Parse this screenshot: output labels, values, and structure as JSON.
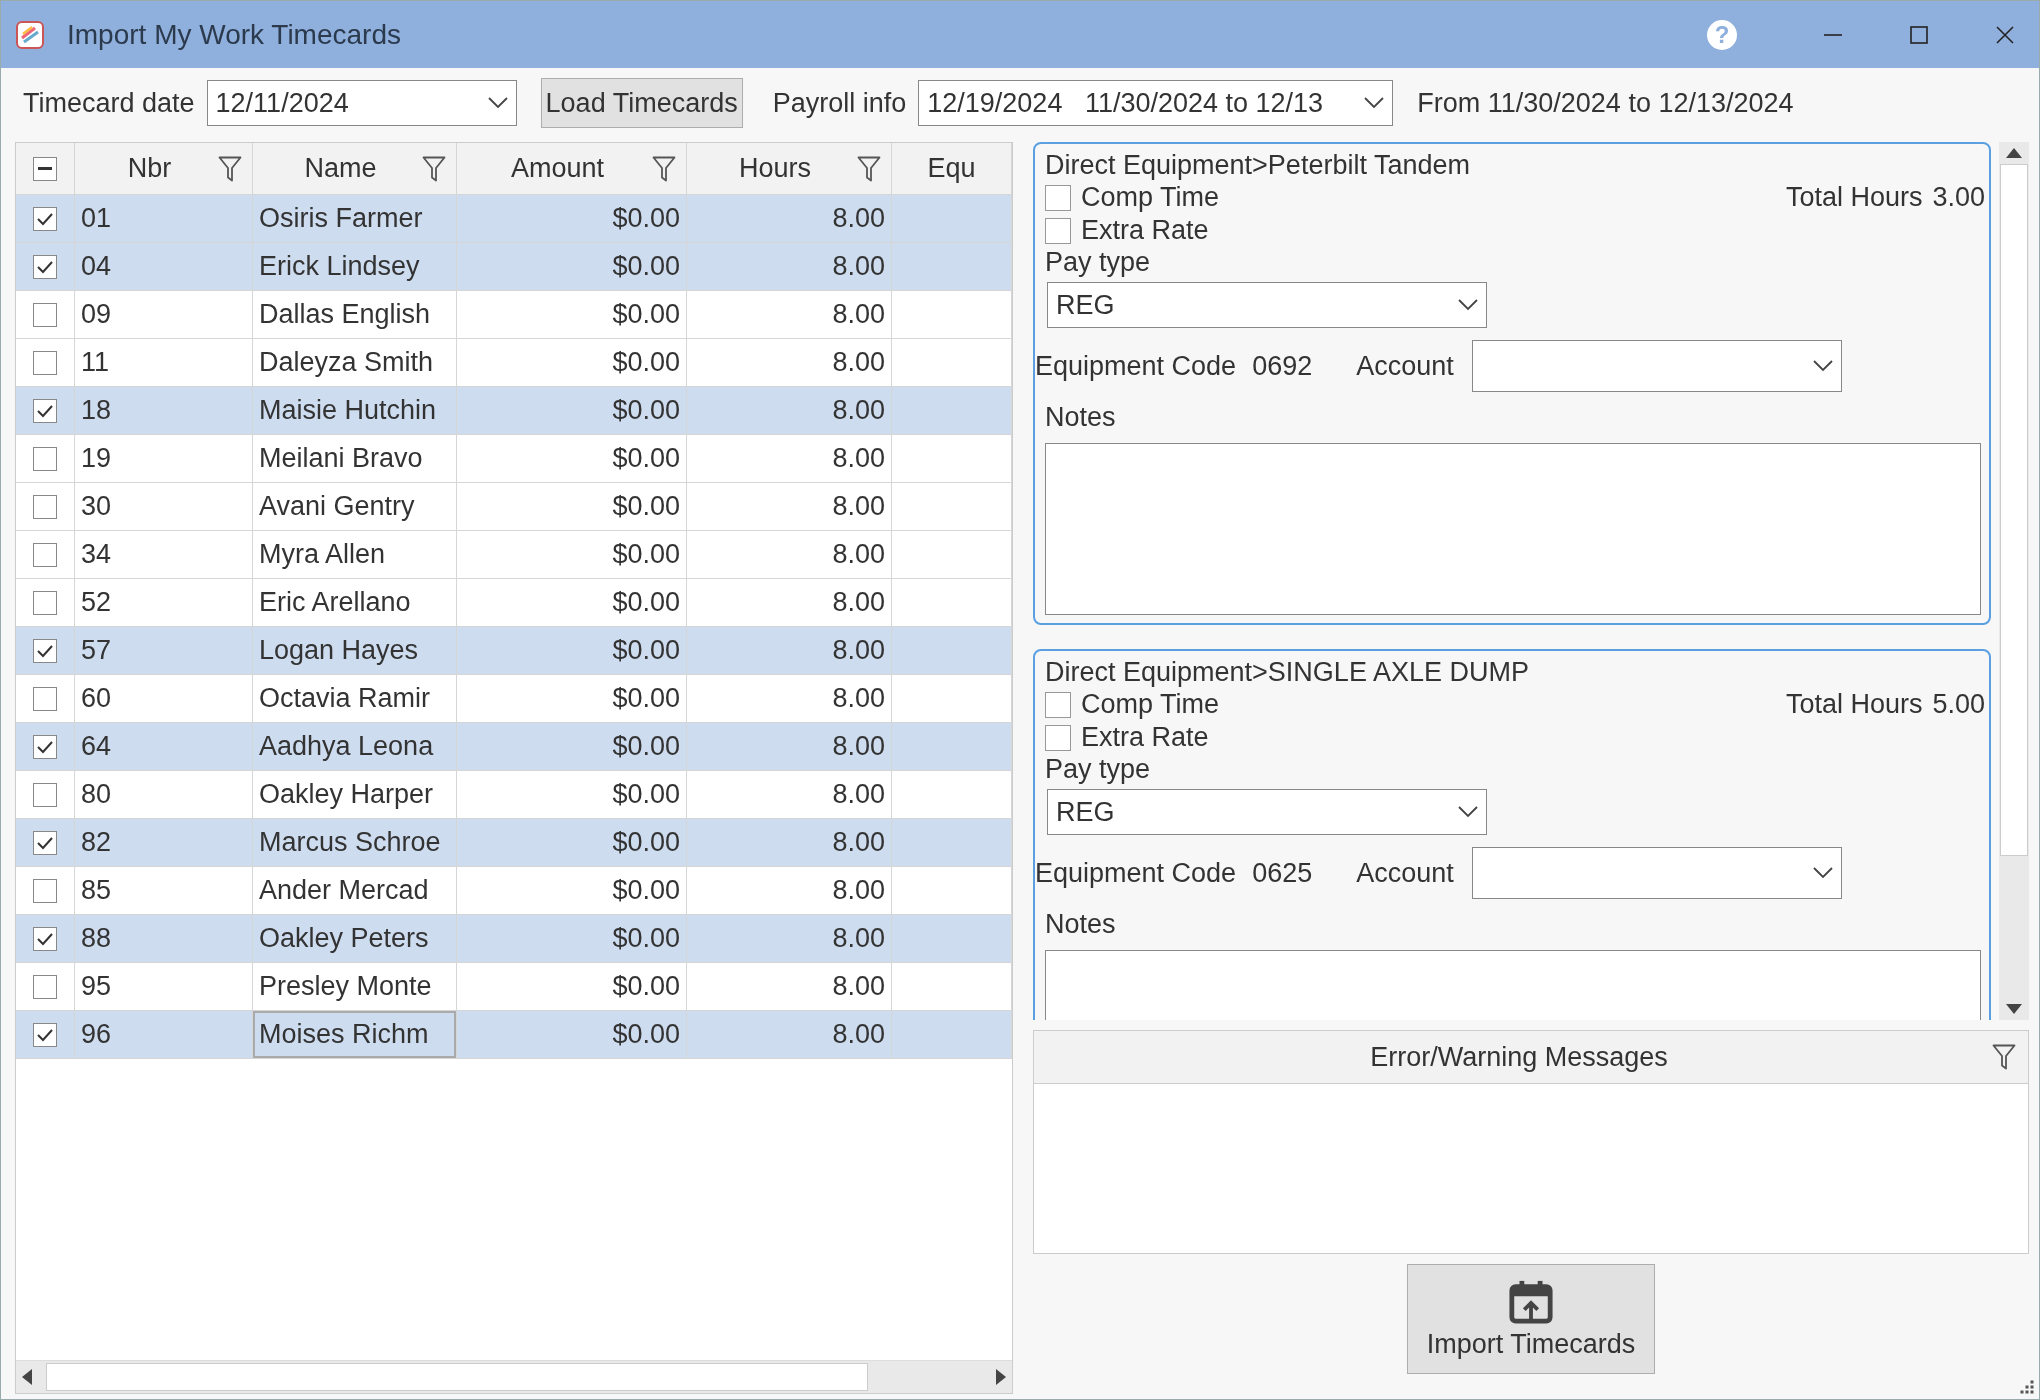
{
  "window": {
    "title": "Import My Work Timecards",
    "help": "?"
  },
  "toolbar": {
    "timecard_date_label": "Timecard date",
    "timecard_date": "12/11/2024",
    "load_button": "Load Timecards",
    "payroll_label": "Payroll info",
    "payroll_value": "12/19/2024   11/30/2024 to 12/13",
    "period_text": "From 11/30/2024 to 12/13/2024"
  },
  "table": {
    "select_all": {
      "mixed": true
    },
    "columns": [
      {
        "label": "Nbr",
        "kind": "text",
        "filter": true
      },
      {
        "label": "Name",
        "kind": "text",
        "filter": true
      },
      {
        "label": "Amount",
        "kind": "number",
        "filter": true
      },
      {
        "label": "Hours",
        "kind": "number",
        "filter": true
      },
      {
        "label": "Equ",
        "kind": "text",
        "filter": false
      }
    ],
    "rows": [
      {
        "checked": true,
        "focused": false,
        "cells": [
          "01",
          "Osiris Farmer",
          "$0.00",
          "8.00"
        ]
      },
      {
        "checked": true,
        "focused": false,
        "cells": [
          "04",
          "Erick Lindsey",
          "$0.00",
          "8.00"
        ]
      },
      {
        "checked": false,
        "focused": false,
        "cells": [
          "09",
          "Dallas English",
          "$0.00",
          "8.00"
        ]
      },
      {
        "checked": false,
        "focused": false,
        "cells": [
          "11",
          "Daleyza Smith",
          "$0.00",
          "8.00"
        ]
      },
      {
        "checked": true,
        "focused": false,
        "cells": [
          "18",
          "Maisie Hutchin",
          "$0.00",
          "8.00"
        ]
      },
      {
        "checked": false,
        "focused": false,
        "cells": [
          "19",
          "Meilani Bravo",
          "$0.00",
          "8.00"
        ]
      },
      {
        "checked": false,
        "focused": false,
        "cells": [
          "30",
          "Avani Gentry",
          "$0.00",
          "8.00"
        ]
      },
      {
        "checked": false,
        "focused": false,
        "cells": [
          "34",
          "Myra Allen",
          "$0.00",
          "8.00"
        ]
      },
      {
        "checked": false,
        "focused": false,
        "cells": [
          "52",
          "Eric Arellano",
          "$0.00",
          "8.00"
        ]
      },
      {
        "checked": true,
        "focused": false,
        "cells": [
          "57",
          "Logan Hayes",
          "$0.00",
          "8.00"
        ]
      },
      {
        "checked": false,
        "focused": false,
        "cells": [
          "60",
          "Octavia Ramir",
          "$0.00",
          "8.00"
        ]
      },
      {
        "checked": true,
        "focused": false,
        "cells": [
          "64",
          "Aadhya Leona",
          "$0.00",
          "8.00"
        ]
      },
      {
        "checked": false,
        "focused": false,
        "cells": [
          "80",
          "Oakley Harper",
          "$0.00",
          "8.00"
        ]
      },
      {
        "checked": true,
        "focused": false,
        "cells": [
          "82",
          "Marcus Schroe",
          "$0.00",
          "8.00"
        ]
      },
      {
        "checked": false,
        "focused": false,
        "cells": [
          "85",
          "Ander Mercad",
          "$0.00",
          "8.00"
        ]
      },
      {
        "checked": true,
        "focused": false,
        "cells": [
          "88",
          "Oakley Peters",
          "$0.00",
          "8.00"
        ]
      },
      {
        "checked": false,
        "focused": false,
        "cells": [
          "95",
          "Presley Monte",
          "$0.00",
          "8.00"
        ]
      },
      {
        "checked": true,
        "focused": true,
        "cells": [
          "96",
          "Moises Richm",
          "$0.00",
          "8.00"
        ]
      }
    ]
  },
  "equipment": [
    {
      "title": "Direct Equipment>Peterbilt Tandem",
      "options": [
        {
          "label": "Comp Time",
          "checked": false
        },
        {
          "label": "Extra Rate",
          "checked": false
        }
      ],
      "total_label": "Total Hours",
      "total": "3.00",
      "pay_type_label": "Pay type",
      "pay_type": "REG",
      "code_label": "Equipment Code",
      "code": "0692",
      "account_label": "Account",
      "notes_label": "Notes"
    },
    {
      "title": "Direct Equipment>SINGLE AXLE DUMP",
      "options": [
        {
          "label": "Comp Time",
          "checked": false
        },
        {
          "label": "Extra Rate",
          "checked": false
        }
      ],
      "total_label": "Total Hours",
      "total": "5.00",
      "pay_type_label": "Pay type",
      "pay_type": "REG",
      "code_label": "Equipment Code",
      "code": "0625",
      "account_label": "Account",
      "notes_label": "Notes"
    }
  ],
  "messages": {
    "title": "Error/Warning Messages"
  },
  "import_button": "Import Timecards"
}
